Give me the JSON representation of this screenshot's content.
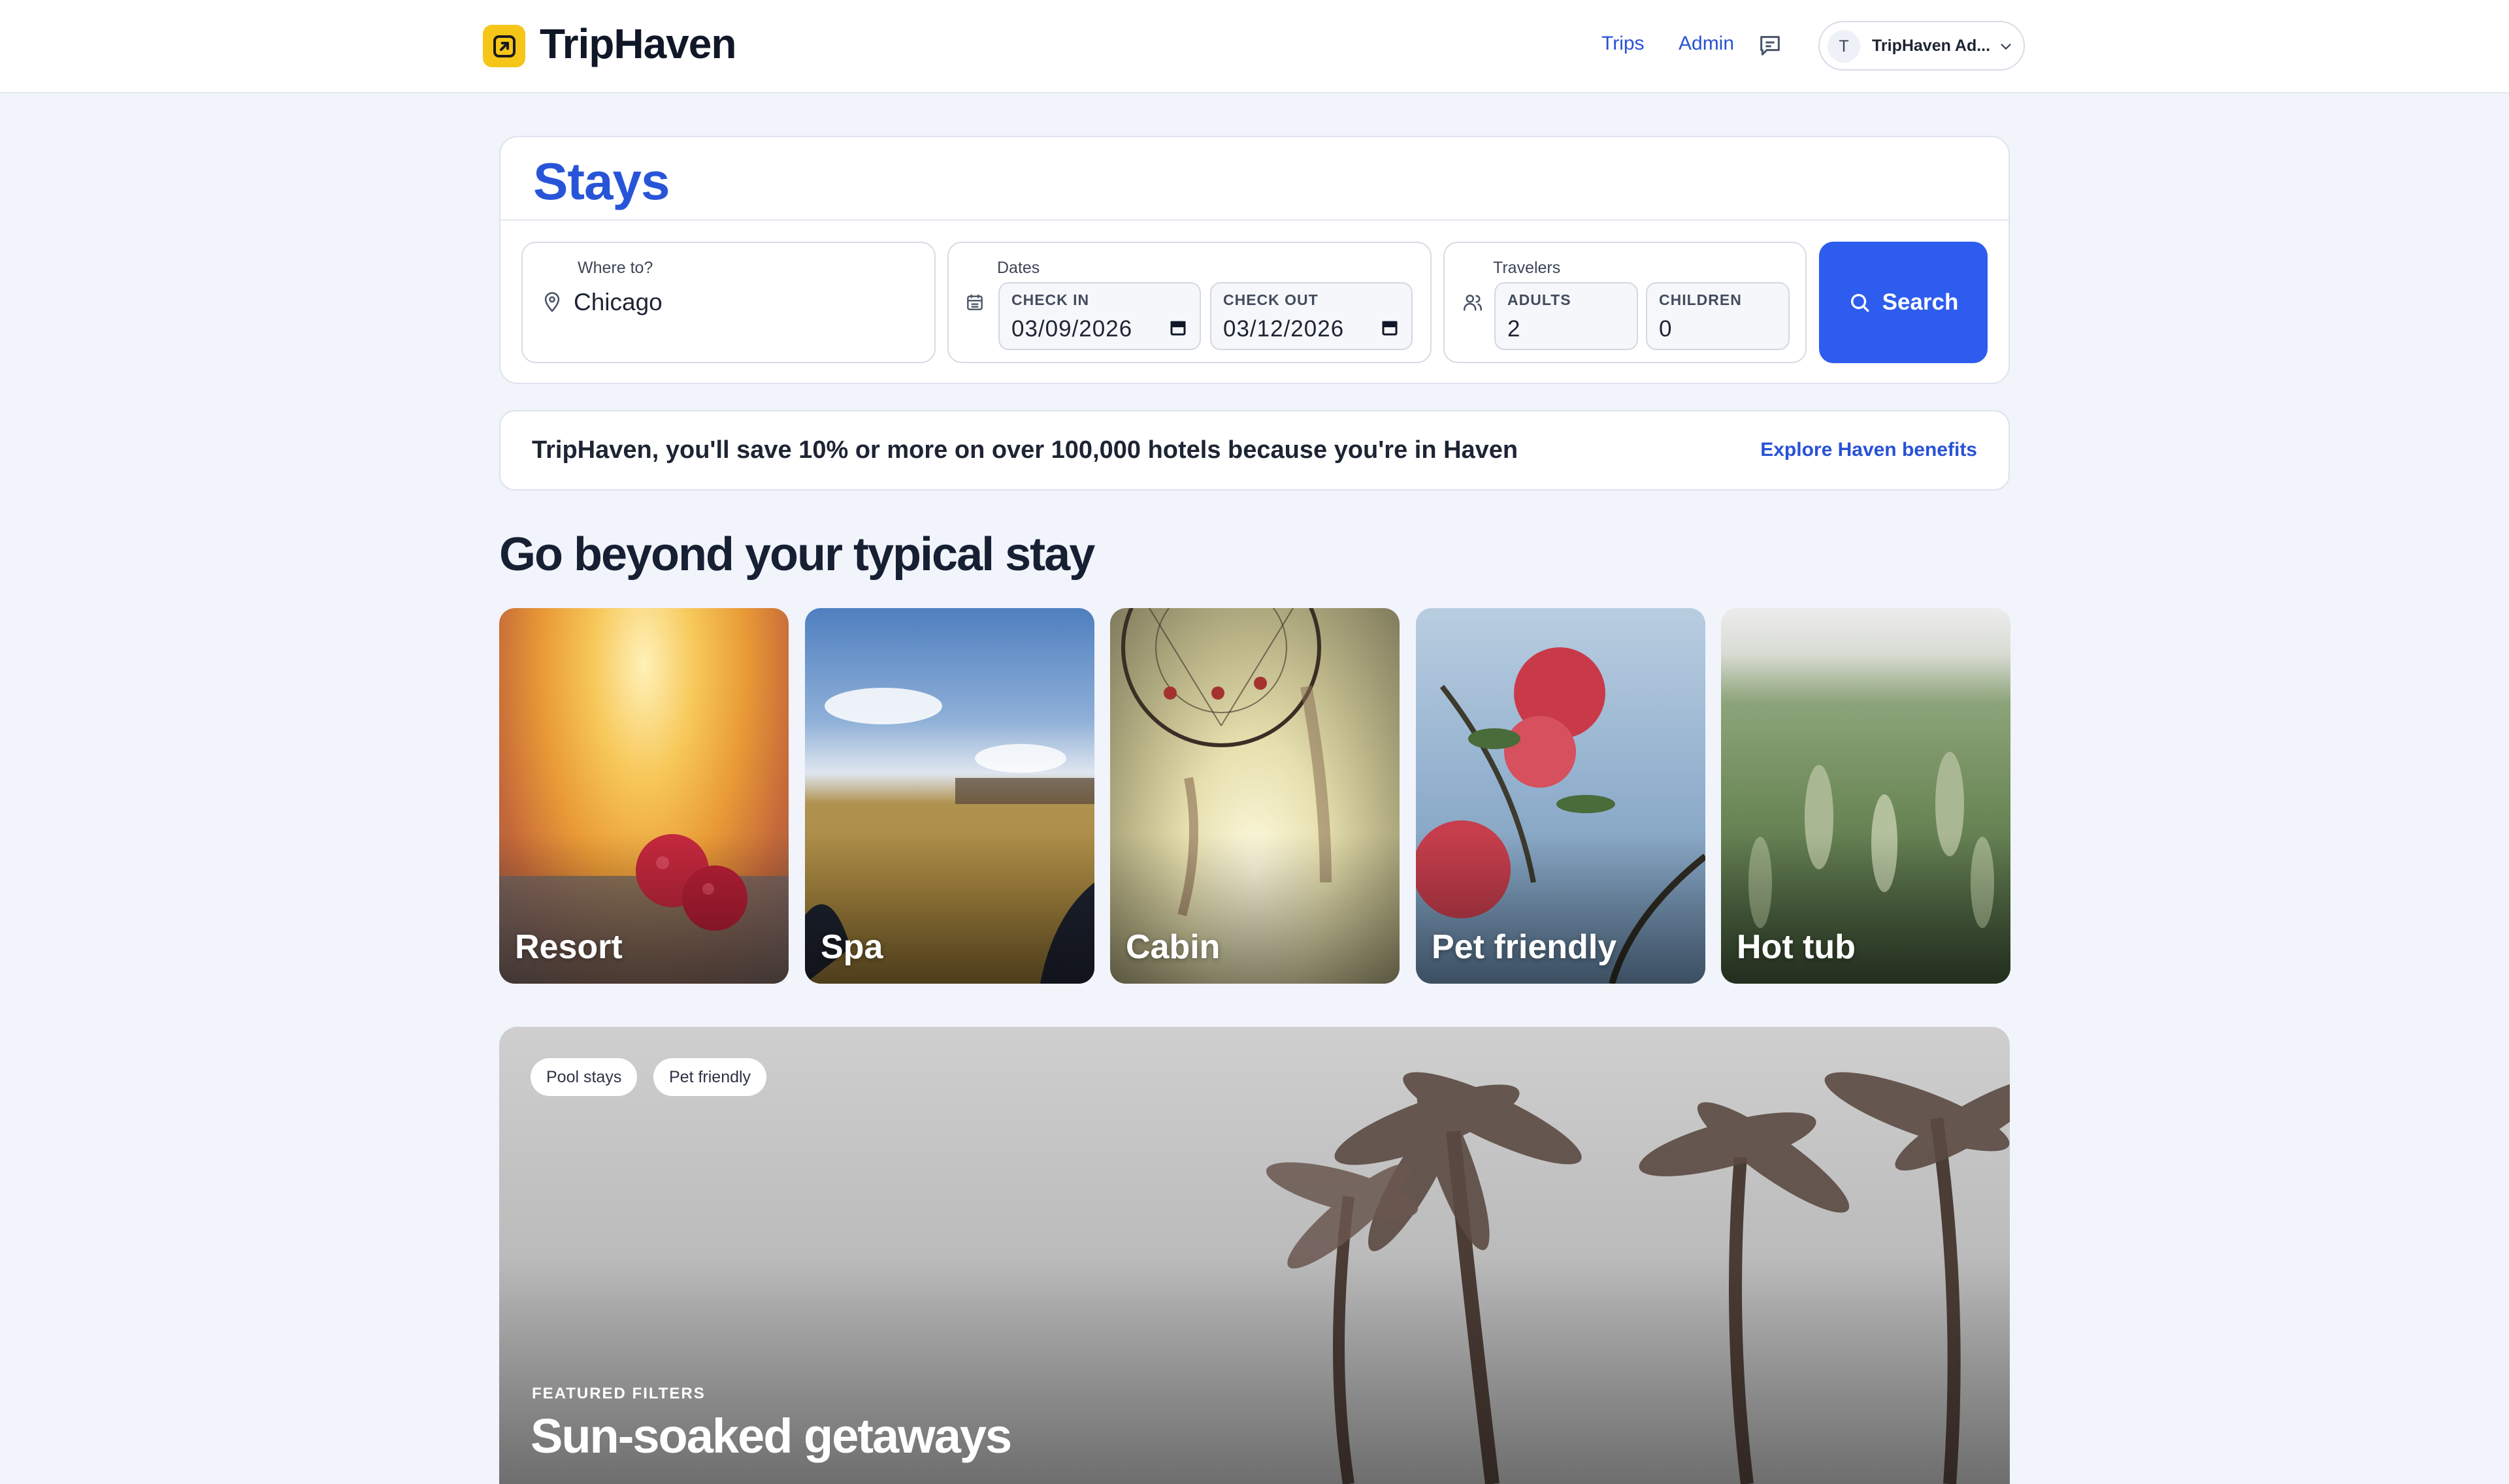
{
  "header": {
    "brand": "TripHaven",
    "nav": [
      {
        "label": "Trips"
      },
      {
        "label": "Admin"
      }
    ],
    "account": {
      "initial": "T",
      "name": "TripHaven Ad..."
    },
    "colors": {
      "brand_yellow": "#f5c518",
      "link_blue": "#2852d6"
    }
  },
  "stays": {
    "title": "Stays",
    "where": {
      "label": "Where to?",
      "value": "Chicago"
    },
    "dates": {
      "label": "Dates",
      "check_in": {
        "label": "CHECK IN",
        "value": "03/09/2026"
      },
      "check_out": {
        "label": "CHECK OUT",
        "value": "03/12/2026"
      }
    },
    "travelers": {
      "label": "Travelers",
      "adults": {
        "label": "ADULTS",
        "value": "2"
      },
      "children": {
        "label": "CHILDREN",
        "value": "0"
      }
    },
    "search_label": "Search",
    "accent": "#2d5cee"
  },
  "promo": {
    "text": "TripHaven, you'll save 10% or more on over 100,000 hotels because you're in Haven",
    "link": "Explore Haven benefits"
  },
  "categories": {
    "title": "Go beyond your typical stay",
    "items": [
      {
        "label": "Resort"
      },
      {
        "label": "Spa"
      },
      {
        "label": "Cabin"
      },
      {
        "label": "Pet friendly"
      },
      {
        "label": "Hot tub"
      }
    ]
  },
  "featured": {
    "chips": [
      "Pool stays",
      "Pet friendly"
    ],
    "kicker": "FEATURED FILTERS",
    "title": "Sun-soaked getaways"
  }
}
